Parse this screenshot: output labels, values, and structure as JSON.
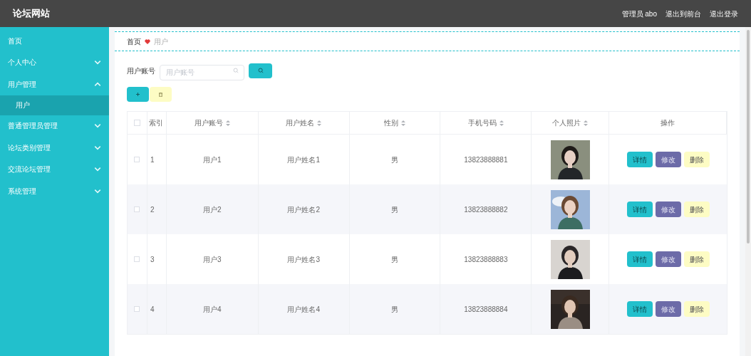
{
  "header": {
    "title": "论坛网站",
    "links": [
      "管理员 abo",
      "退出到前台",
      "退出登录"
    ]
  },
  "sidebar": {
    "items": [
      {
        "label": "首页"
      },
      {
        "label": "个人中心",
        "expanded": false
      },
      {
        "label": "用户管理",
        "expanded": true,
        "children": [
          {
            "label": "用户",
            "selected": true
          }
        ]
      },
      {
        "label": "普通管理员管理",
        "expanded": false
      },
      {
        "label": "论坛类别管理",
        "expanded": false
      },
      {
        "label": "交流论坛管理",
        "expanded": false
      },
      {
        "label": "系统管理",
        "expanded": false
      }
    ]
  },
  "breadcrumb": [
    "首页",
    "用户"
  ],
  "search": {
    "label": "用户账号",
    "placeholder": "用户账号"
  },
  "table": {
    "select_all_checked": false,
    "columns": [
      {
        "label": "索引",
        "sortable": false
      },
      {
        "label": "用户账号",
        "sortable": true
      },
      {
        "label": "用户姓名",
        "sortable": true
      },
      {
        "label": "性别",
        "sortable": true
      },
      {
        "label": "手机号码",
        "sortable": true
      },
      {
        "label": "个人照片",
        "sortable": true
      },
      {
        "label": "操作",
        "sortable": false
      }
    ],
    "rows": [
      {
        "checked": false,
        "cells": [
          "1",
          "用户1",
          "用户姓名1",
          "男",
          "13823888881"
        ],
        "photo": {
          "kind": "picture"
        },
        "actions": [
          "详情",
          "修改",
          "删除"
        ]
      },
      {
        "checked": false,
        "cells": [
          "2",
          "用户2",
          "用户姓名2",
          "男",
          "13823888882"
        ],
        "photo": {
          "kind": "picture"
        },
        "actions": [
          "详情",
          "修改",
          "删除"
        ]
      },
      {
        "checked": false,
        "cells": [
          "3",
          "用户3",
          "用户姓名3",
          "男",
          "13823888883"
        ],
        "photo": {
          "kind": "picture"
        },
        "actions": [
          "详情",
          "修改",
          "删除"
        ]
      },
      {
        "checked": false,
        "cells": [
          "4",
          "用户4",
          "用户姓名4",
          "男",
          "13823888884"
        ],
        "photo": {
          "kind": "picture"
        },
        "actions": [
          "详情",
          "修改",
          "删除"
        ]
      }
    ]
  }
}
